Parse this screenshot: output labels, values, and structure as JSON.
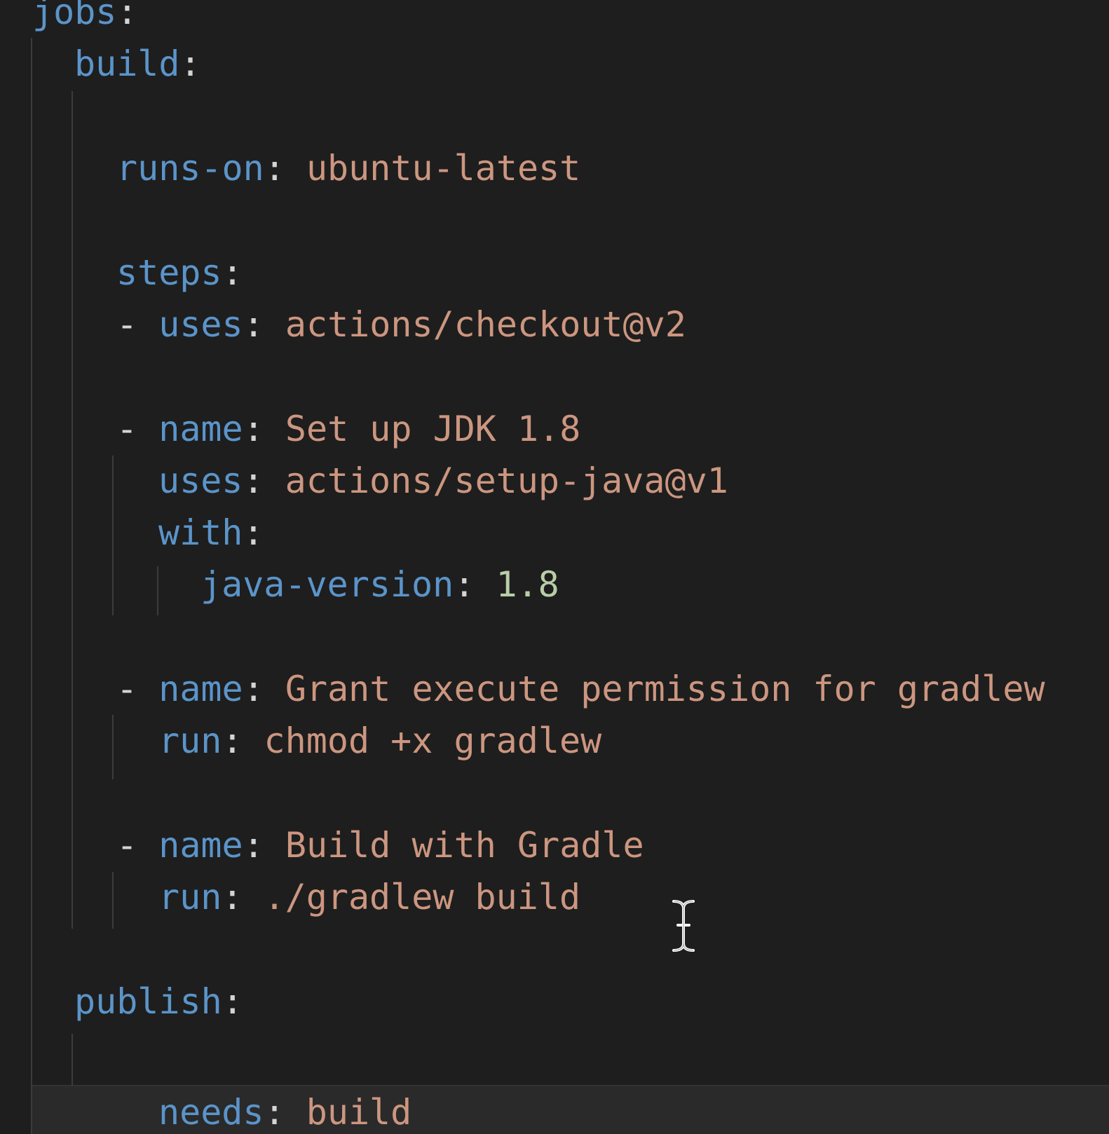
{
  "editor": {
    "language": "yaml",
    "lines": [
      {
        "key": "jobs",
        "colon": ":"
      },
      {
        "key": "build",
        "colon": ":"
      },
      {
        "key": "runs-on",
        "colon": ":",
        "value": "ubuntu-latest"
      },
      {
        "key": "steps",
        "colon": ":"
      },
      {
        "dash": "-",
        "key": "uses",
        "colon": ":",
        "value": "actions/checkout@v2"
      },
      {
        "dash": "-",
        "key": "name",
        "colon": ":",
        "value": "Set up JDK 1.8"
      },
      {
        "key": "uses",
        "colon": ":",
        "value": "actions/setup-java@v1"
      },
      {
        "key": "with",
        "colon": ":"
      },
      {
        "key": "java-version",
        "colon": ":",
        "value": "1.8"
      },
      {
        "dash": "-",
        "key": "name",
        "colon": ":",
        "value": "Grant execute permission for gradlew"
      },
      {
        "key": "run",
        "colon": ":",
        "value": "chmod +x gradlew"
      },
      {
        "dash": "-",
        "key": "name",
        "colon": ":",
        "value": "Build with Gradle"
      },
      {
        "key": "run",
        "colon": ":",
        "value": "./gradlew build"
      },
      {
        "key": "publish",
        "colon": ":"
      },
      {
        "key": "needs",
        "colon": ":",
        "value": "build"
      }
    ]
  },
  "colors": {
    "background": "#1e1e1e",
    "key": "#5b94c9",
    "string": "#cc9680",
    "number": "#b9cda7",
    "punctuation": "#d4d4d4",
    "indent_guide": "#3c3c3c",
    "current_line": "#2a2a2a"
  },
  "cursor": {
    "type": "text-ibeam-icon"
  }
}
